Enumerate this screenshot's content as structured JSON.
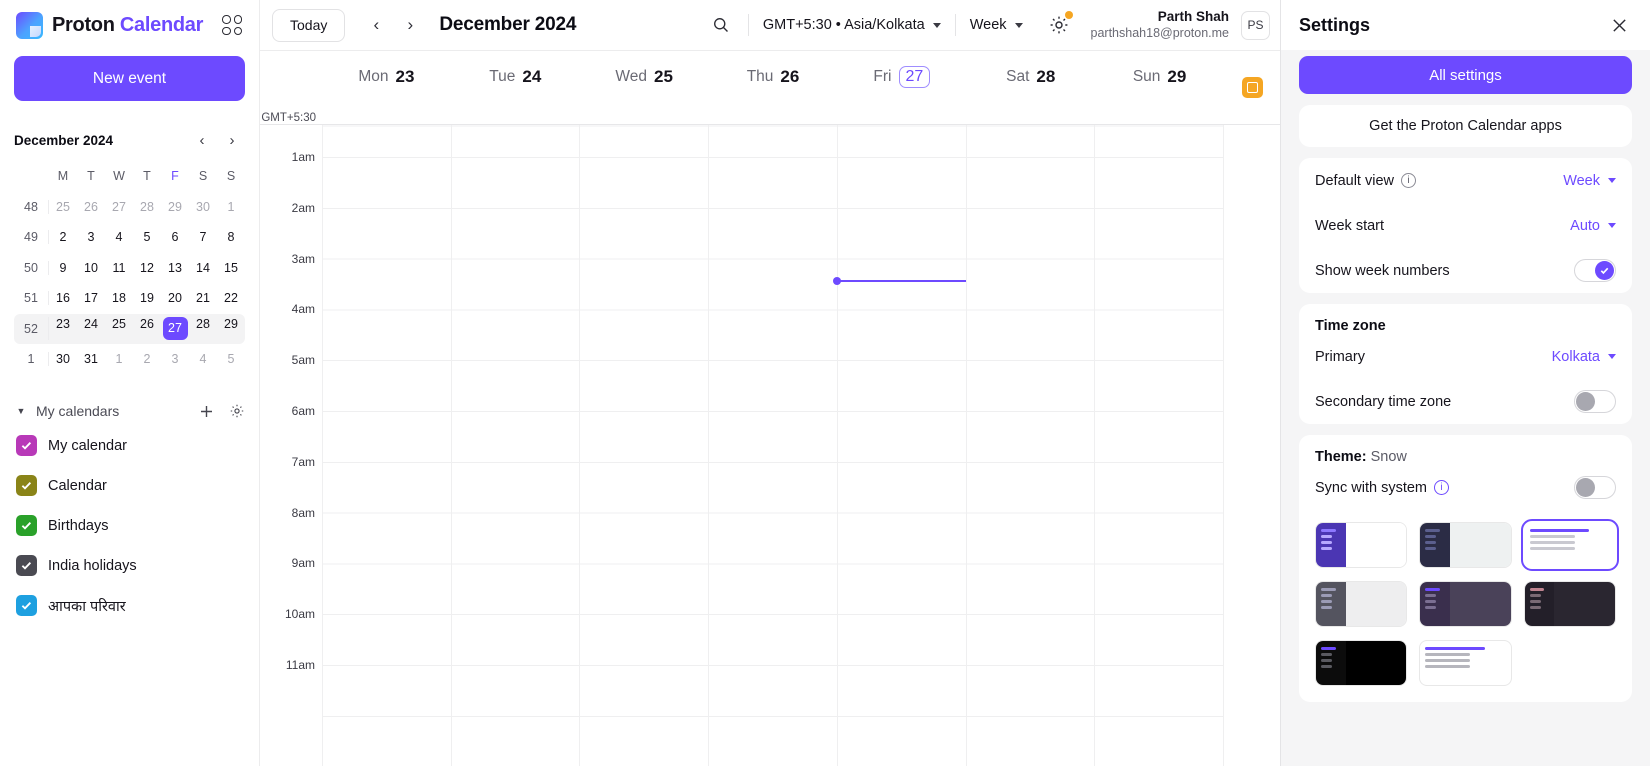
{
  "brand": {
    "word1": "Proton",
    "word2": "Calendar",
    "apps_icon": "apps-grid-icon"
  },
  "sidebar": {
    "new_event_label": "New event",
    "mini_calendar": {
      "title": "December 2024",
      "prev_icon": "chevron-left-icon",
      "next_icon": "chevron-right-icon",
      "dow": [
        "M",
        "T",
        "W",
        "T",
        "F",
        "S",
        "S"
      ],
      "highlight_dow_index": 4,
      "weeks": [
        {
          "num": "48",
          "days": [
            "25",
            "26",
            "27",
            "28",
            "29",
            "30",
            "1"
          ],
          "out": [
            true,
            true,
            true,
            true,
            true,
            true,
            true
          ],
          "selected": -1,
          "row_highlight": false
        },
        {
          "num": "49",
          "days": [
            "2",
            "3",
            "4",
            "5",
            "6",
            "7",
            "8"
          ],
          "out": [
            false,
            false,
            false,
            false,
            false,
            false,
            false
          ],
          "selected": -1,
          "row_highlight": false
        },
        {
          "num": "50",
          "days": [
            "9",
            "10",
            "11",
            "12",
            "13",
            "14",
            "15"
          ],
          "out": [
            false,
            false,
            false,
            false,
            false,
            false,
            false
          ],
          "selected": -1,
          "row_highlight": false
        },
        {
          "num": "51",
          "days": [
            "16",
            "17",
            "18",
            "19",
            "20",
            "21",
            "22"
          ],
          "out": [
            false,
            false,
            false,
            false,
            false,
            false,
            false
          ],
          "selected": -1,
          "row_highlight": false
        },
        {
          "num": "52",
          "days": [
            "23",
            "24",
            "25",
            "26",
            "27",
            "28",
            "29"
          ],
          "out": [
            false,
            false,
            false,
            false,
            false,
            false,
            false
          ],
          "selected": 4,
          "row_highlight": true
        },
        {
          "num": "1",
          "days": [
            "30",
            "31",
            "1",
            "2",
            "3",
            "4",
            "5"
          ],
          "out": [
            false,
            false,
            true,
            true,
            true,
            true,
            true
          ],
          "selected": -1,
          "row_highlight": false
        }
      ]
    },
    "calendars_section": {
      "caret_icon": "caret-down-icon",
      "title": "My calendars",
      "add_icon": "plus-icon",
      "settings_icon": "gear-icon",
      "items": [
        {
          "label": "My calendar",
          "color": "#b839b8",
          "checked": true
        },
        {
          "label": "Calendar",
          "color": "#8a8418",
          "checked": true
        },
        {
          "label": "Birthdays",
          "color": "#2aa12a",
          "checked": true
        },
        {
          "label": "India holidays",
          "color": "#4a4a52",
          "checked": true
        },
        {
          "label": "आपका परिवार",
          "color": "#1ea0e0",
          "checked": true
        }
      ]
    }
  },
  "toolbar": {
    "today_label": "Today",
    "prev_icon": "chevron-left-icon",
    "next_icon": "chevron-right-icon",
    "current_range": "December 2024",
    "search_icon": "search-icon",
    "timezone_label": "GMT+5:30 • Asia/Kolkata",
    "view_label": "Week",
    "settings_icon": "gear-icon",
    "settings_badge": "notification-dot",
    "user_name": "Parth Shah",
    "user_email": "parthshah18@proton.me",
    "avatar_initials": "PS"
  },
  "calendar": {
    "timezone_gutter_label": "GMT+5:30",
    "days": [
      {
        "dow": "Mon",
        "num": "23",
        "today": false
      },
      {
        "dow": "Tue",
        "num": "24",
        "today": false
      },
      {
        "dow": "Wed",
        "num": "25",
        "today": false
      },
      {
        "dow": "Thu",
        "num": "26",
        "today": false
      },
      {
        "dow": "Fri",
        "num": "27",
        "today": true
      },
      {
        "dow": "Sat",
        "num": "28",
        "today": false
      },
      {
        "dow": "Sun",
        "num": "29",
        "today": false
      }
    ],
    "hours": [
      "1am",
      "2am",
      "3am",
      "4am",
      "5am",
      "6am",
      "7am",
      "8am",
      "9am",
      "10am",
      "11am"
    ],
    "now_indicator": {
      "day_index": 4,
      "color": "#6d4aff"
    },
    "mini_app_badge": "calendar-widget-icon"
  },
  "settings": {
    "title": "Settings",
    "close_icon": "close-icon",
    "all_settings_label": "All settings",
    "get_apps_label": "Get the Proton Calendar apps",
    "layout": {
      "default_view": {
        "label": "Default view",
        "info_icon": "info-icon",
        "value": "Week"
      },
      "week_start": {
        "label": "Week start",
        "value": "Auto"
      },
      "show_week_numbers": {
        "label": "Show week numbers",
        "on": true
      }
    },
    "time_zone": {
      "section_title": "Time zone",
      "primary": {
        "label": "Primary",
        "value": "Kolkata"
      },
      "secondary": {
        "label": "Secondary time zone",
        "on": false
      }
    },
    "theme": {
      "prefix": "Theme:",
      "name": "Snow",
      "sync_label": "Sync with system",
      "sync_info_icon": "info-icon",
      "sync_on": false,
      "swatches": [
        {
          "name": "Proton",
          "sidebar": "#4b36b3",
          "body": "#ffffff",
          "accent": "#8d78ff",
          "line": "#b7a8ff",
          "selected": false,
          "wide": false
        },
        {
          "name": "Carbon",
          "sidebar": "#2b2c45",
          "body": "#eef1f1",
          "accent": "#5b5f8e",
          "line": "#5b5f8e",
          "selected": false,
          "wide": false
        },
        {
          "name": "Snow",
          "sidebar": "#ffffff",
          "body": "#ffffff",
          "accent": "#6d4aff",
          "line": "#c9c9d0",
          "selected": true,
          "wide": true
        },
        {
          "name": "Contrast light",
          "sidebar": "#54545f",
          "body": "#eeeeef",
          "accent": "#9b9bb5",
          "line": "#9b9bb5",
          "selected": false,
          "wide": false
        },
        {
          "name": "Monokai",
          "sidebar": "#3a2f4d",
          "body": "#4a4259",
          "accent": "#6d4aff",
          "line": "#7b6f92",
          "selected": false,
          "wide": false
        },
        {
          "name": "Contrast dark",
          "sidebar": "#231f29",
          "body": "#2a2630",
          "accent": "#c08490",
          "line": "#7a6a74",
          "selected": false,
          "wide": false
        },
        {
          "name": "Legacy",
          "sidebar": "#0c0c0c",
          "body": "#000000",
          "accent": "#6d4aff",
          "line": "#5a5a60",
          "selected": false,
          "wide": false
        },
        {
          "name": "Duotone",
          "sidebar": "#ffffff",
          "body": "#ffffff",
          "accent": "#6d4aff",
          "line": "#b6b6bd",
          "selected": false,
          "wide": true
        }
      ]
    }
  }
}
